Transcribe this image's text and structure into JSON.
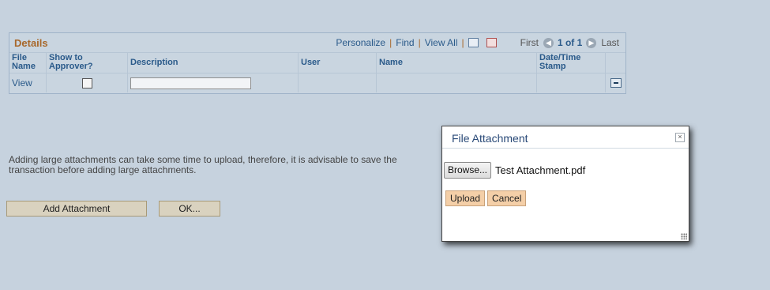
{
  "details": {
    "title": "Details",
    "nav": {
      "personalize": "Personalize",
      "find": "Find",
      "view_all": "View All",
      "first": "First",
      "page_info": "1 of 1",
      "last": "Last"
    },
    "columns": [
      "File Name",
      "Show to Approver?",
      "Description",
      "User",
      "Name",
      "Date/Time Stamp"
    ],
    "rows": [
      {
        "file_link": "View",
        "show_to_approver": false,
        "description": "",
        "user": "",
        "name": "",
        "datetime": ""
      }
    ]
  },
  "note": "Adding large attachments can take some time to upload, therefore, it is advisable to save the transaction before adding large attachments.",
  "buttons": {
    "add_attachment": "Add Attachment",
    "ok": "OK..."
  },
  "dialog": {
    "title": "File Attachment",
    "close": "×",
    "browse": "Browse...",
    "file_name": "Test Attachment.pdf",
    "upload": "Upload",
    "cancel": "Cancel"
  }
}
